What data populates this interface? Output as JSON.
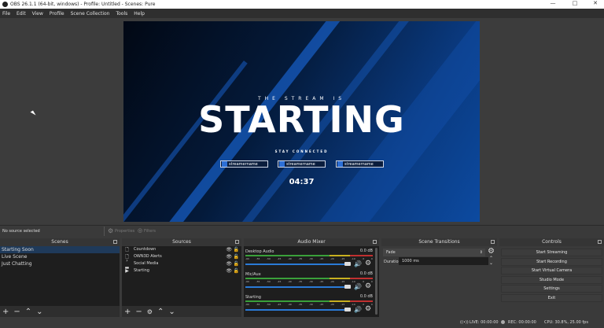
{
  "window": {
    "title": "OBS 26.1.1 (64-bit, windows) - Profile: Untitled - Scenes: Pure",
    "controls": [
      "—",
      "□",
      "✕"
    ]
  },
  "menu": [
    "File",
    "Edit",
    "View",
    "Profile",
    "Scene Collection",
    "Tools",
    "Help"
  ],
  "preview": {
    "kicker": "THE STREAM IS",
    "headline": "STARTING",
    "subtitle": "STAY CONNECTED",
    "socials": [
      {
        "icon": "twitter-icon",
        "handle": "streamername"
      },
      {
        "icon": "instagram-icon",
        "handle": "streamername"
      },
      {
        "icon": "youtube-icon",
        "handle": "streamername"
      }
    ],
    "countdown": "04:37"
  },
  "source_toolbar": {
    "status": "No source selected",
    "properties": "Properties",
    "filters": "Filters"
  },
  "scenes": {
    "title": "Scenes",
    "items": [
      "Starting Soon",
      "Live Scene",
      "Just Chatting"
    ],
    "selected": 0
  },
  "sources": {
    "title": "Sources",
    "items": [
      {
        "icon": "text-file-icon",
        "name": "Countdown"
      },
      {
        "icon": "text-file-icon",
        "name": "OWN3D Alerts"
      },
      {
        "icon": "folder-icon",
        "name": "Social Media"
      },
      {
        "icon": "play-icon",
        "name": "Starting"
      }
    ]
  },
  "mixer": {
    "title": "Audio Mixer",
    "scale": [
      "-60",
      "-55",
      "-50",
      "-45",
      "-40",
      "-35",
      "-30",
      "-25",
      "-20",
      "-15",
      "-10",
      "-5",
      "0"
    ],
    "channels": [
      {
        "name": "Desktop Audio",
        "db": "0.0 dB",
        "volume": 1.0
      },
      {
        "name": "Mic/Aux",
        "db": "0.0 dB",
        "volume": 1.0
      },
      {
        "name": "Starting",
        "db": "0.0 dB",
        "volume": 1.0
      }
    ]
  },
  "transitions": {
    "title": "Scene Transitions",
    "selected": "Fade",
    "duration_label": "Duration",
    "duration": "1000 ms"
  },
  "controls": {
    "title": "Controls",
    "buttons": [
      "Start Streaming",
      "Start Recording",
      "Start Virtual Camera",
      "Studio Mode",
      "Settings",
      "Exit"
    ]
  },
  "status": {
    "live": "LIVE: 00:00:00",
    "rec": "REC: 00:00:00",
    "cpu": "CPU: 30.8%, 25.00 fps"
  }
}
